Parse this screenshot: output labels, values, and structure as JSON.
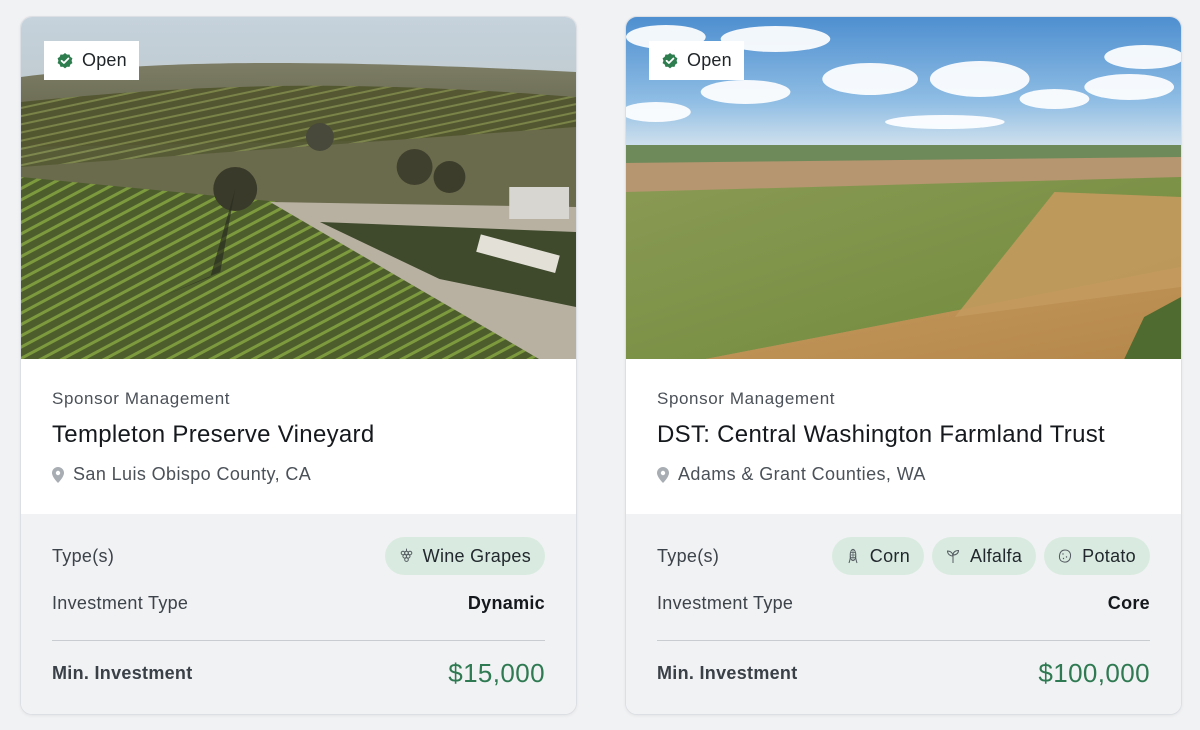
{
  "cards": [
    {
      "status": "Open",
      "sponsor": "Sponsor Management",
      "title": "Templeton Preserve Vineyard",
      "location": "San Luis Obispo County, CA",
      "types_label": "Type(s)",
      "types": [
        {
          "label": "Wine Grapes",
          "icon": "grapes-icon"
        }
      ],
      "investment_type_label": "Investment Type",
      "investment_type": "Dynamic",
      "min_investment_label": "Min. Investment",
      "min_investment": "$15,000",
      "image": "vineyard-aerial-photo"
    },
    {
      "status": "Open",
      "sponsor": "Sponsor Management",
      "title": "DST: Central Washington Farmland Trust",
      "location": "Adams & Grant Counties, WA",
      "types_label": "Type(s)",
      "types": [
        {
          "label": "Corn",
          "icon": "corn-icon"
        },
        {
          "label": "Alfalfa",
          "icon": "sprout-icon"
        },
        {
          "label": "Potato",
          "icon": "potato-icon"
        }
      ],
      "investment_type_label": "Investment Type",
      "investment_type": "Core",
      "min_investment_label": "Min. Investment",
      "min_investment": "$100,000",
      "image": "farmland-aerial-photo"
    }
  ],
  "colors": {
    "accent_green": "#2f7a52",
    "chip_bg": "#d9ebe0",
    "badge_check": "#2e7d4f",
    "page_bg": "#f1f2f4"
  }
}
